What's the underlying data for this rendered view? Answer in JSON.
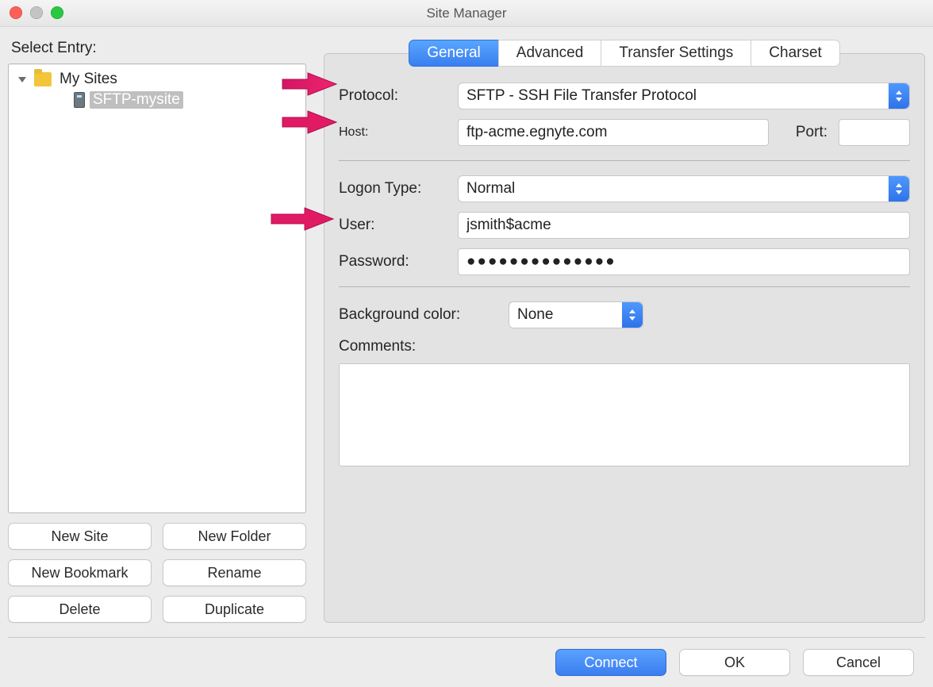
{
  "window": {
    "title": "Site Manager"
  },
  "sidebar": {
    "title": "Select Entry:",
    "root": {
      "label": "My Sites",
      "icon": "folder"
    },
    "items": [
      {
        "label": "SFTP-mysite",
        "icon": "server",
        "selected": true
      }
    ],
    "buttons": {
      "new_site": "New Site",
      "new_folder": "New Folder",
      "new_bookmark": "New Bookmark",
      "rename": "Rename",
      "delete": "Delete",
      "duplicate": "Duplicate"
    }
  },
  "tabs": {
    "general": "General",
    "advanced": "Advanced",
    "transfer": "Transfer Settings",
    "charset": "Charset",
    "selected": "general"
  },
  "general": {
    "protocol_label": "Protocol:",
    "protocol_value": "SFTP - SSH File Transfer Protocol",
    "host_label": "Host:",
    "host_value": "ftp-acme.egnyte.com",
    "port_label": "Port:",
    "port_value": "",
    "logon_type_label": "Logon Type:",
    "logon_type_value": "Normal",
    "user_label": "User:",
    "user_value": "jsmith$acme",
    "password_label": "Password:",
    "password_value": "●●●●●●●●●●●●●●",
    "bg_color_label": "Background color:",
    "bg_color_value": "None",
    "comments_label": "Comments:",
    "comments_value": ""
  },
  "footer": {
    "connect": "Connect",
    "ok": "OK",
    "cancel": "Cancel"
  },
  "annotations": {
    "arrows": [
      {
        "target": "protocol"
      },
      {
        "target": "host"
      },
      {
        "target": "logon_type"
      }
    ],
    "color": "#e01b64"
  }
}
